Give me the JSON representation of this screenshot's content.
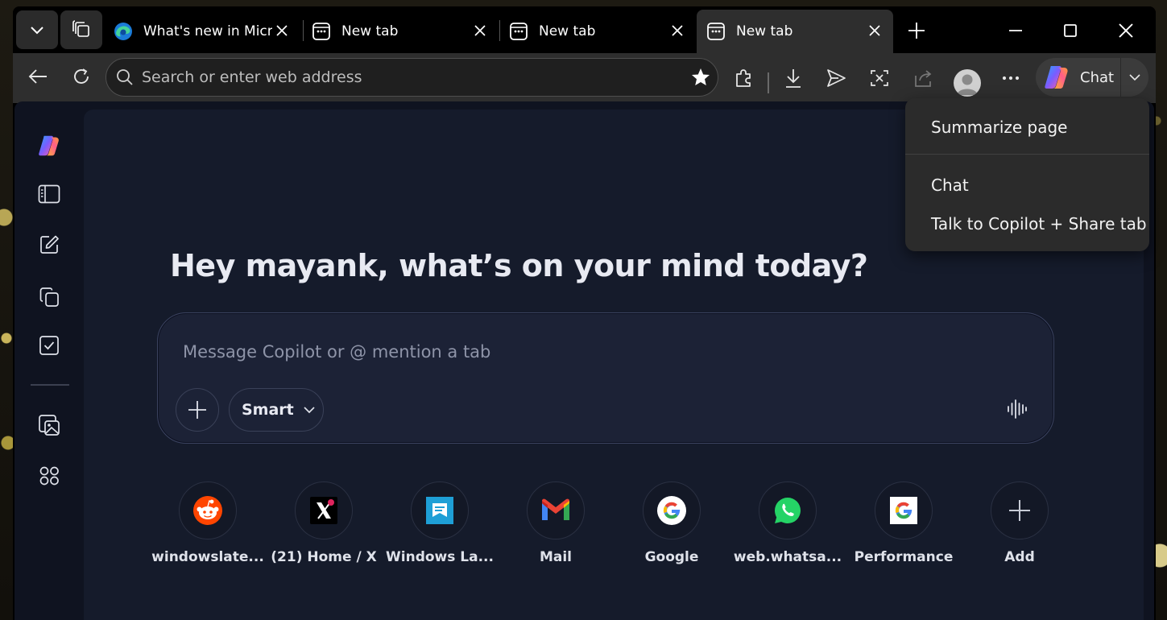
{
  "browser": {
    "tabs": [
      {
        "title": "What's new in Microsoft Edge",
        "favicon": "edge-icon",
        "active": false
      },
      {
        "title": "New tab",
        "favicon": "new-tab-icon",
        "active": false
      },
      {
        "title": "New tab",
        "favicon": "new-tab-icon",
        "active": false
      },
      {
        "title": "New tab",
        "favicon": "new-tab-icon",
        "active": true
      }
    ],
    "address_placeholder": "Search or enter web address",
    "chat_label": "Chat"
  },
  "chat_menu": {
    "items": [
      "Summarize page",
      "Chat",
      "Talk to Copilot + Share tab"
    ]
  },
  "copilot": {
    "greeting": "Hey mayank, what’s on your mind today?",
    "composer_placeholder": "Message Copilot or @ mention a tab",
    "mode_label": "Smart"
  },
  "shortcuts": [
    {
      "label": "windowslate...",
      "icon": "reddit-icon"
    },
    {
      "label": "(21) Home / X",
      "icon": "x-icon"
    },
    {
      "label": "Windows La...",
      "icon": "windows-latest-icon"
    },
    {
      "label": "Mail",
      "icon": "gmail-icon"
    },
    {
      "label": "Google",
      "icon": "google-icon"
    },
    {
      "label": "web.whatsa...",
      "icon": "whatsapp-icon"
    },
    {
      "label": "Performance",
      "icon": "google-icon"
    },
    {
      "label": "Add",
      "icon": "plus-icon"
    }
  ],
  "colors": {
    "toolbar_bg": "#2e2e2e",
    "content_bg": "#151b2b",
    "reddit": "#ff4500",
    "whatsapp": "#25d366",
    "windows_latest": "#1e9fd6"
  }
}
